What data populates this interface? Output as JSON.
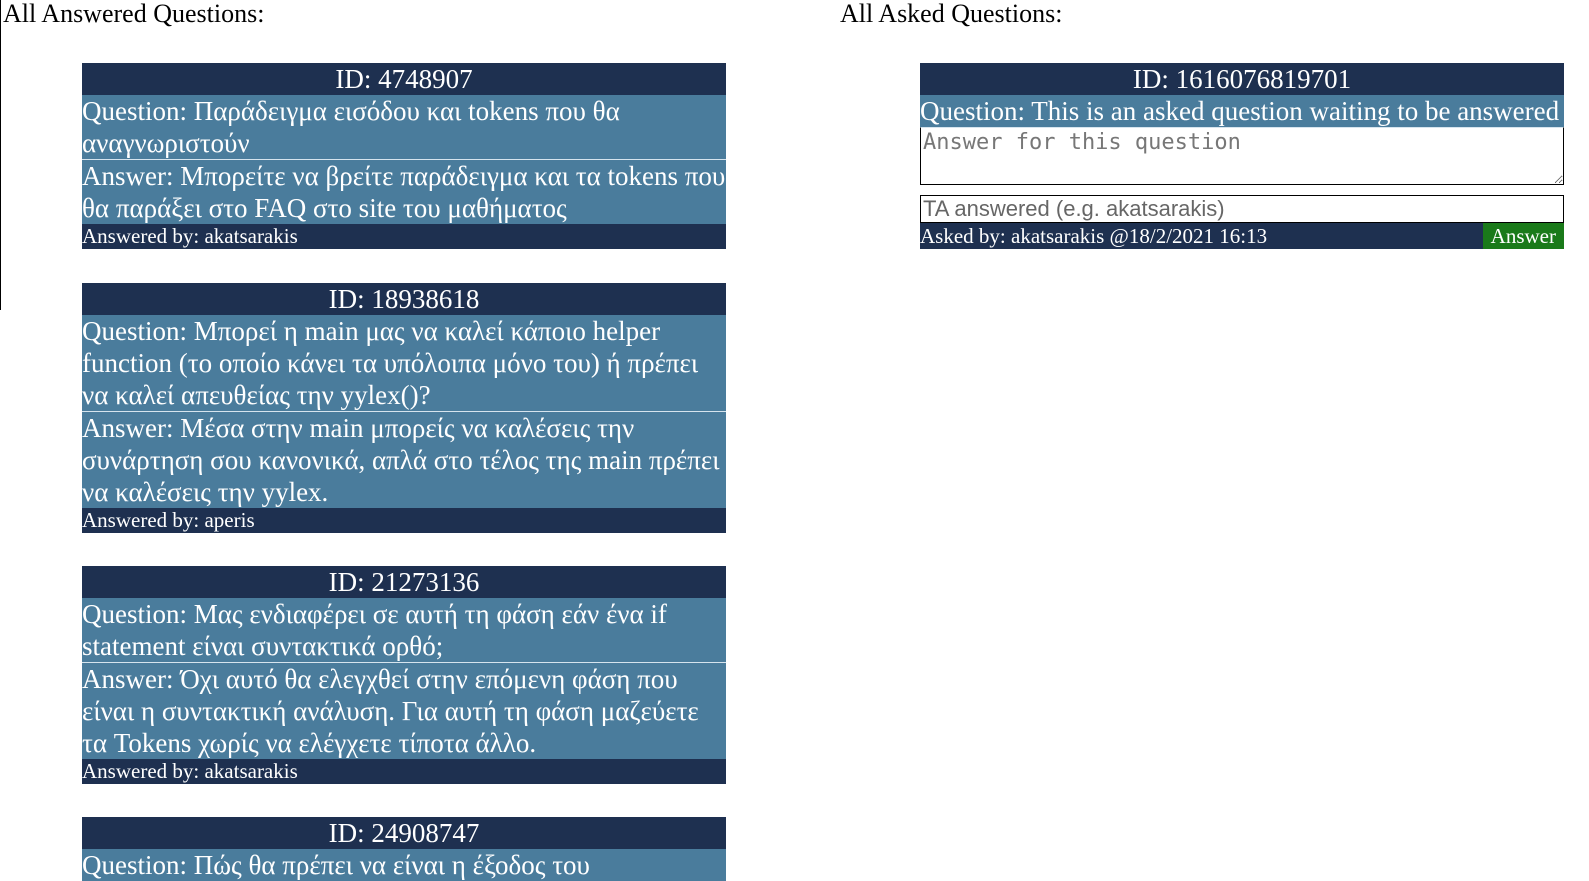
{
  "headings": {
    "answered": "All Answered Questions:",
    "asked": "All Asked Questions:"
  },
  "answered": [
    {
      "id": "ID: 4748907",
      "question": "Question: Παράδειγμα εισόδου και tokens που θα αναγνωριστούν",
      "answer": "Answer: Μπορείτε να βρείτε παράδειγμα και τα tokens που θα παράξει στο FAQ στο site του μαθήματος",
      "by": "Answered by: akatsarakis"
    },
    {
      "id": "ID: 18938618",
      "question": "Question: Μπορεί η main μας να καλεί κάποιο helper function (το οποίο κάνει τα υπόλοιπα μόνο του) ή πρέπει να καλεί απευθείας την yylex()?",
      "answer": "Answer: Μέσα στην main μπορείς να καλέσεις την συνάρτηση σου κανονικά, απλά στο τέλος της main πρέπει να καλέσεις την yylex.",
      "by": "Answered by: aperis"
    },
    {
      "id": "ID: 21273136",
      "question": "Question: Μας ενδιαφέρει σε αυτή τη φάση εάν ένα if statement είναι συντακτικά ορθό;",
      "answer": "Answer: Όχι αυτό θα ελεγχθεί στην επόμενη φάση που είναι η συντακτική ανάλυση. Για αυτή τη φάση μαζεύετε τα Tokens χωρίς να ελέγχετε τίποτα άλλο.",
      "by": "Answered by: akatsarakis"
    },
    {
      "id": "ID: 24908747",
      "question": "Question: Πώς θα πρέπει να είναι η έξοδος του"
    }
  ],
  "asked": [
    {
      "id": "ID: 1616076819701",
      "question": "Question: This is an asked question waiting to be answered",
      "answer_placeholder": "Answer for this question",
      "ta_placeholder": "TA answered (e.g. akatsarakis)",
      "asked_by": "Asked by: akatsarakis @18/2/2021 16:13",
      "button_label": "Answer"
    }
  ],
  "colors": {
    "card_header": "#1e3050",
    "card_body": "#4a7c9c",
    "answer_button": "#1a7a1a"
  }
}
